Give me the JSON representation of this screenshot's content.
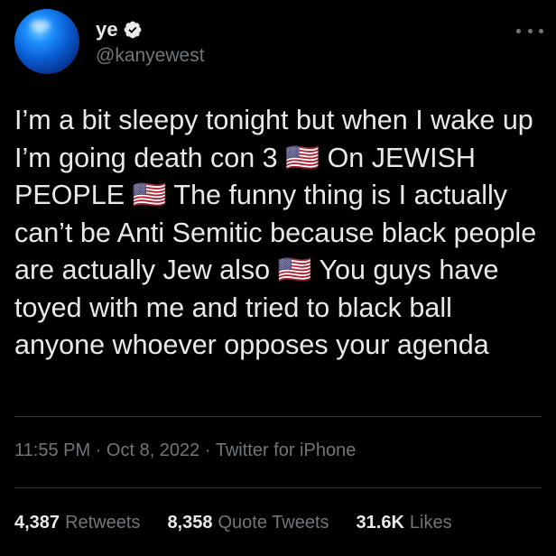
{
  "tweet": {
    "author": {
      "display_name": "ye",
      "handle": "@kanyewest",
      "verified": true,
      "avatar_icon": "blue-orb-avatar"
    },
    "text": "I’m a bit sleepy tonight but when I wake up I’m going death con 3 🇺🇸 On JEWISH PEOPLE 🇺🇸 The funny thing is I actually can’t be Anti Semitic because black people are actually Jew also 🇺🇸 You guys have toyed with me and tried to black ball anyone whoever opposes your agenda",
    "timestamp": "11:55 PM · Oct 8, 2022 · Twitter for iPhone",
    "stats": {
      "retweets_count": "4,387",
      "retweets_label": "Retweets",
      "quotes_count": "8,358",
      "quotes_label": "Quote Tweets",
      "likes_count": "31.6K",
      "likes_label": "Likes"
    }
  },
  "colors": {
    "background": "#000000",
    "primary_text": "#e7e9ea",
    "secondary_text": "#71767b",
    "divider": "#2f3336",
    "verified_badge": "#e7e9ea"
  }
}
